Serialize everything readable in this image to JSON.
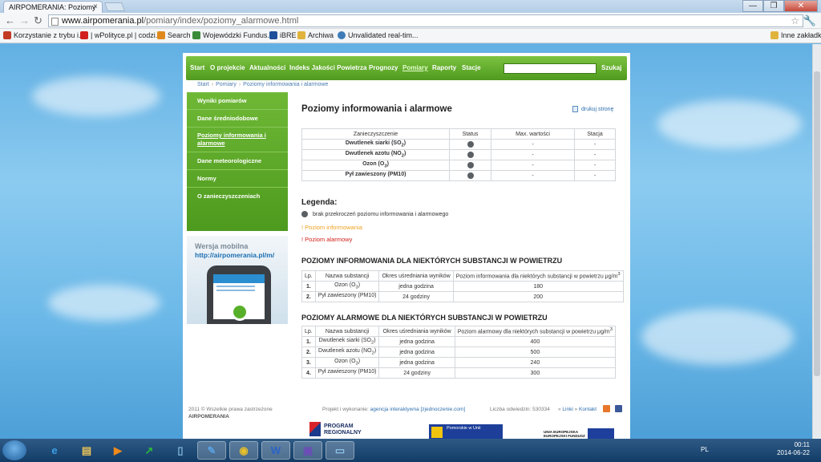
{
  "browser": {
    "tab_title": "AIRPOMERANIA: Poziomy",
    "tab_close": "×",
    "url_domain": "www.airpomerania.pl",
    "url_path": "/pomiary/index/poziomy_alarmowe.html",
    "window_controls": [
      "—",
      "❐",
      "✕"
    ],
    "nav_back": "←",
    "nav_forward": "→",
    "reload": "↻",
    "star": "☆",
    "wrench": "🔧",
    "bookmarks": [
      {
        "label": "Korzystanie z trybu i...",
        "icon": "folder-icon",
        "color": "#c23b22"
      },
      {
        "label": "| wPolityce.pl | codzi...",
        "icon": "wp-icon",
        "color": "#d11f1f"
      },
      {
        "label": "Search",
        "icon": "search-icon",
        "color": "#e08a1e"
      },
      {
        "label": "Wojewódzki Fundus...",
        "icon": "wfos-icon",
        "color": "#3a8a3a"
      },
      {
        "label": "iBRE",
        "icon": "ibre-icon",
        "color": "#1d4f9a"
      },
      {
        "label": "Archiwa",
        "icon": "folder-icon",
        "color": "#e0b43c"
      },
      {
        "label": "Unvalidated real-tim...",
        "icon": "gear-icon",
        "color": "#3d7bb8"
      }
    ],
    "other_bookmarks": "Inne zakładki"
  },
  "site": {
    "menu": [
      {
        "label": "Start",
        "active": false
      },
      {
        "label": "O projekcie",
        "active": false
      },
      {
        "label": "Aktualności",
        "active": false
      },
      {
        "label": "Indeks Jakości Powietrza",
        "active": false
      },
      {
        "label": "Prognozy",
        "active": false
      },
      {
        "label": "Pomiary",
        "active": true
      },
      {
        "label": "Raporty",
        "active": false
      },
      {
        "label": "Stacje",
        "active": false
      }
    ],
    "search_button": "Szukaj",
    "breadcrumb": [
      "Start",
      "Pomiary",
      "Poziomy informowania i alarmowe"
    ],
    "sidebar": [
      {
        "label": "Wyniki pomiarów",
        "active": false
      },
      {
        "label": "Dane średniodobowe",
        "active": false
      },
      {
        "label": "Poziomy informowania i alarmowe",
        "active": true
      },
      {
        "label": "Dane meteorologiczne",
        "active": false
      },
      {
        "label": "Normy",
        "active": false
      },
      {
        "label": "O zanieczyszczeniach",
        "active": false
      }
    ],
    "mobile_promo": {
      "title": "Wersja mobilna",
      "url": "http://airpomerania.pl/m/"
    },
    "page_title": "Poziomy informowania i alarmowe",
    "print_label": "drukuj stronę",
    "status_table": {
      "headers": [
        "Zanieczyszczenie",
        "Status",
        "Max. wartości",
        "Stacja"
      ],
      "rows": [
        {
          "name": "Dwutlenek siarki (SO",
          "sub": "2",
          "tail": ")",
          "max": "-",
          "station": "-"
        },
        {
          "name": "Dwutlenek azotu (NO",
          "sub": "2",
          "tail": ")",
          "max": "-",
          "station": "-"
        },
        {
          "name": "Ozon (O",
          "sub": "3",
          "tail": ")",
          "max": "-",
          "station": "-"
        },
        {
          "name": "Pył zawieszony (PM10)",
          "sub": "",
          "tail": "",
          "max": "-",
          "station": "-"
        }
      ]
    },
    "legend": {
      "heading": "Legenda:",
      "gray": "brak przekroczeń poziomu informowania i alarmowego",
      "info": "! Poziom informowania",
      "alarm": "! Poziom alarmowy"
    },
    "info_section": {
      "heading": "POZIOMY INFORMOWANIA DLA NIEKTÓRYCH SUBSTANCJI W POWIETRZU",
      "headers": [
        "Lp.",
        "Nazwa substancji",
        "Okres uśredniania wyników",
        "Poziom informowania dla niektórych substancji w powietrzu μg/m",
        "3"
      ],
      "rows": [
        {
          "lp": "1.",
          "name": "Ozon (O",
          "sub": "3",
          "tail": ")",
          "period": "jedna godzina",
          "value": "180"
        },
        {
          "lp": "2.",
          "name": "Pył zawieszony (PM10)",
          "sub": "",
          "tail": "",
          "period": "24 godziny",
          "value": "200"
        }
      ]
    },
    "alarm_section": {
      "heading": "POZIOMY ALARMOWE DLA NIEKTÓRYCH SUBSTANCJI W POWIETRZU",
      "headers": [
        "Lp.",
        "Nazwa substancji",
        "Okres uśredniania wyników",
        "Poziom alarmowy dla niektórych substancji w powietrzu μg/m",
        "3"
      ],
      "rows": [
        {
          "lp": "1.",
          "name": "Dwutlenek siarki (SO",
          "sub": "2",
          "tail": ")",
          "period": "jedna godzina",
          "value": "400"
        },
        {
          "lp": "2.",
          "name": "Dwutlenek azotu (NO",
          "sub": "2",
          "tail": ")",
          "period": "jedna godzina",
          "value": "500"
        },
        {
          "lp": "3.",
          "name": "Ozon (O",
          "sub": "3",
          "tail": ")",
          "period": "jedna godzina",
          "value": "240"
        },
        {
          "lp": "4.",
          "name": "Pył zawieszony (PM10)",
          "sub": "",
          "tail": "",
          "period": "24 godziny",
          "value": "300"
        }
      ]
    },
    "footer": {
      "copyright": "2011 © Wszelkie prawa zastrzeżone",
      "brand": "AIRPOMERANIA",
      "project_label": "Projekt i wykonanie:",
      "project_link": "agencja interaktywna [zjednoczenie.com]",
      "visits": "Liczba odwiedzin: 530334",
      "links": "Linki",
      "contact": "Kontakt",
      "program_line1": "PROGRAM",
      "program_line2": "REGIONALNY",
      "pomorskie": "Pomorskie w Unii",
      "ue_line1": "UNIA EUROPEJSKA",
      "ue_line2": "EUROPEJSKI FUNDUSZ"
    }
  },
  "taskbar": {
    "lang": "PL",
    "time": "00:11",
    "date": "2014-06-22",
    "apps": [
      {
        "icon": "ie-icon",
        "glyph": "e",
        "color": "#3aa0e8"
      },
      {
        "icon": "explorer-icon",
        "glyph": "▤",
        "color": "#e8c25a"
      },
      {
        "icon": "media-player-icon",
        "glyph": "▶",
        "color": "#f08a1a"
      },
      {
        "icon": "monitor-icon",
        "glyph": "↗",
        "color": "#2db83a"
      },
      {
        "icon": "notes-icon",
        "glyph": "▯",
        "color": "#7fb4d8"
      },
      {
        "icon": "paint-icon",
        "glyph": "✎",
        "color": "#5aa0e0"
      },
      {
        "icon": "chrome-icon",
        "glyph": "◉",
        "color": "#e8c02a"
      },
      {
        "icon": "word-icon",
        "glyph": "W",
        "color": "#2b63c6"
      },
      {
        "icon": "save-icon",
        "glyph": "▣",
        "color": "#6d4bb8"
      },
      {
        "icon": "window-icon",
        "glyph": "▭",
        "color": "#8cc0e8"
      }
    ]
  }
}
